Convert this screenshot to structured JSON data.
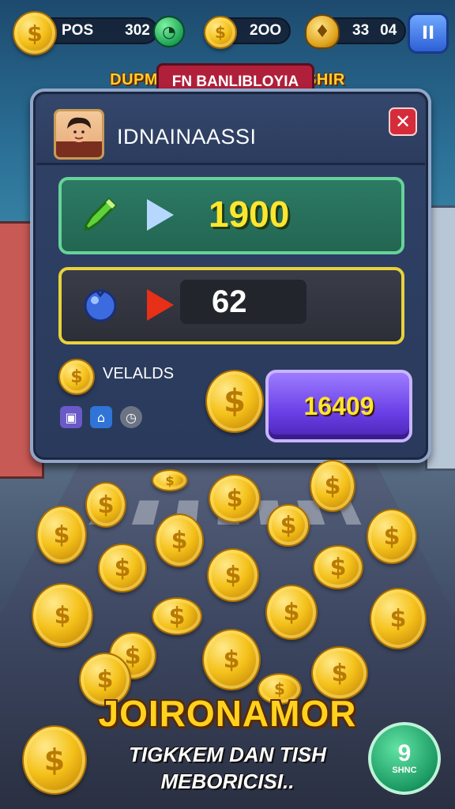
{
  "hud": {
    "label_left": "POS",
    "value_left": "302",
    "value_mid": "2OO",
    "value_right_1": "33",
    "value_right_2": "04",
    "pause_glyph": "II"
  },
  "banner": {
    "outer_text": "DUPMNAIN                  INISHIR",
    "inner_text": "FN BANLIBLOYIA"
  },
  "panel": {
    "player_name": "IDNAINAASSI",
    "close_glyph": "✕",
    "row_green_value": "1900",
    "row_yellow_value": "62",
    "rewards_label": "VELALDS",
    "total_value": "16409"
  },
  "bottom": {
    "title": "JOIRONAMOR",
    "line1": "TIGKKEM DAN TISH",
    "line2": "MEBORICISI..",
    "timer_number": "9",
    "timer_sub": "SHNC"
  },
  "icons": {
    "coin": "coin-icon",
    "gem": "gem-icon",
    "trophy": "trophy-icon",
    "pencil": "pencil-gem-icon",
    "berry": "blue-berry-icon"
  },
  "colors": {
    "coin_gold": "#f5c21b",
    "row_green_border": "#67d29a",
    "row_yellow_border": "#e8d23a",
    "total_button": "#6a3fe6",
    "close_red": "#d52c3b"
  }
}
